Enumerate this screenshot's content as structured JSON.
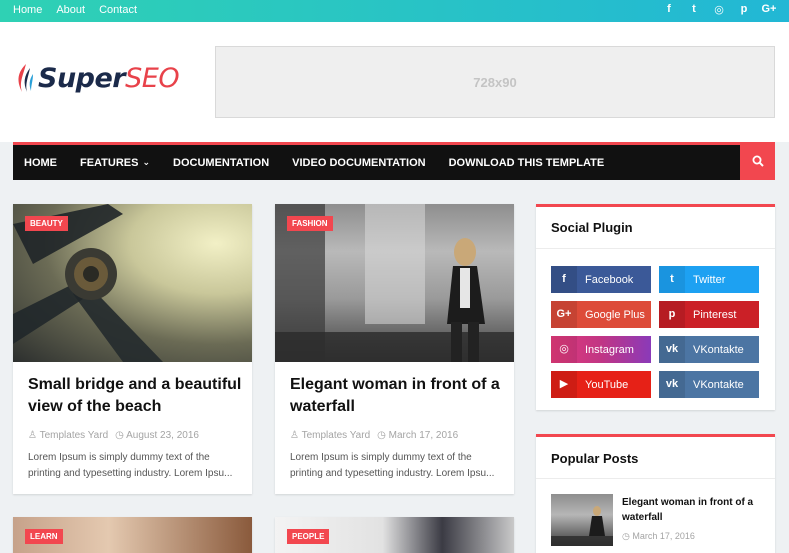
{
  "topbar": {
    "links": [
      "Home",
      "About",
      "Contact"
    ],
    "social_icons": [
      "facebook-icon",
      "twitter-icon",
      "instagram-icon",
      "pinterest-icon",
      "google-plus-icon"
    ],
    "social_glyphs": [
      "f",
      "t",
      "◎",
      "p",
      "G+"
    ]
  },
  "header": {
    "logo_super": "Super",
    "logo_seo": "SEO",
    "ad_text": "728x90"
  },
  "nav": {
    "items": [
      "HOME",
      "FEATURES",
      "DOCUMENTATION",
      "VIDEO DOCUMENTATION",
      "DOWNLOAD THIS TEMPLATE"
    ],
    "caret": "⌄"
  },
  "posts": [
    {
      "label": "BEAUTY",
      "title": "Small bridge and a beautiful view of the beach",
      "author": "Templates Yard",
      "date": "August 23, 2016",
      "excerpt": "Lorem Ipsum is simply dummy text of the printing and typesetting industry. Lorem Ipsu..."
    },
    {
      "label": "FASHION",
      "title": "Elegant woman in front of a waterfall",
      "author": "Templates Yard",
      "date": "March 17, 2016",
      "excerpt": "Lorem Ipsum is simply dummy text of the printing and typesetting industry. Lorem Ipsu..."
    },
    {
      "label": "LEARN"
    },
    {
      "label": "PEOPLE"
    }
  ],
  "sidebar": {
    "social_title": "Social Plugin",
    "social_buttons": [
      {
        "label": "Facebook",
        "glyph": "f",
        "color": "#3b5998"
      },
      {
        "label": "Twitter",
        "glyph": "t",
        "color": "#1da1f2"
      },
      {
        "label": "Google Plus",
        "glyph": "G+",
        "color": "#dd4b39"
      },
      {
        "label": "Pinterest",
        "glyph": "p",
        "color": "#cb2027"
      },
      {
        "label": "Instagram",
        "glyph": "◎",
        "color": "#c13584"
      },
      {
        "label": "VKontakte",
        "glyph": "vk",
        "color": "#4c75a3"
      },
      {
        "label": "YouTube",
        "glyph": "▶",
        "color": "#e62117"
      },
      {
        "label": "VKontakte",
        "glyph": "vk",
        "color": "#4c75a3"
      }
    ],
    "popular_title": "Popular Posts",
    "popular": {
      "title": "Elegant woman in front of a waterfall",
      "date": "March 17, 2016"
    }
  },
  "colors": {
    "accent": "#f2474f",
    "nav_bg": "#111111"
  }
}
